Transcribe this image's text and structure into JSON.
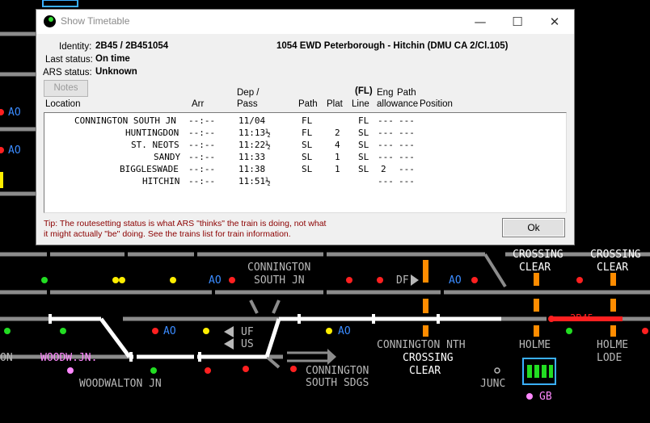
{
  "window": {
    "title": "Show Timetable",
    "controls": {
      "minimize": "—",
      "maximize": "☐",
      "close": "✕"
    }
  },
  "header": {
    "identity_label": "Identity:",
    "identity_value": "2B45 / 2B451054",
    "service": "1054 EWD Peterborough - Hitchin (DMU CA 2/Cl.105)",
    "last_status_label": "Last status:",
    "last_status_value": "On time",
    "ars_status_label": "ARS status:",
    "ars_status_value": "Unknown",
    "notes_button": "Notes"
  },
  "columns": {
    "location": "Location",
    "arr": "Arr",
    "dep1": "Dep /",
    "dep2": "Pass",
    "path": "Path",
    "plat": "Plat",
    "fl": "(FL)",
    "line": "Line",
    "eng1": "Eng",
    "eng2": "allowance",
    "path_alw1": "Path",
    "path_alw2": "Position"
  },
  "rows": [
    {
      "location": "CONNINGTON SOUTH JN",
      "arr": "--:--",
      "dep": "11/04",
      "path": "FL",
      "plat": "",
      "line": "FL",
      "eng": "---",
      "pathalw": "---"
    },
    {
      "location": "HUNTINGDON",
      "arr": "--:--",
      "dep": "11:13½",
      "path": "FL",
      "plat": "2",
      "line": "SL",
      "eng": "---",
      "pathalw": "---"
    },
    {
      "location": "ST. NEOTS",
      "arr": "--:--",
      "dep": "11:22½",
      "path": "SL",
      "plat": "4",
      "line": "SL",
      "eng": "---",
      "pathalw": "---"
    },
    {
      "location": "SANDY",
      "arr": "--:--",
      "dep": "11:33",
      "path": "SL",
      "plat": "1",
      "line": "SL",
      "eng": "---",
      "pathalw": "---"
    },
    {
      "location": "BIGGLESWADE",
      "arr": "--:--",
      "dep": "11:38",
      "path": "SL",
      "plat": "1",
      "line": "SL",
      "eng": "2",
      "pathalw": "---"
    },
    {
      "location": "HITCHIN",
      "arr": "--:--",
      "dep": "11:51½",
      "path": "",
      "plat": "",
      "line": "",
      "eng": "---",
      "pathalw": "---"
    }
  ],
  "tip_line1": "Tip: The routesetting status is what ARS \"thinks\" the train is doing, not what",
  "tip_line2": "it might actually \"be\" doing. See the trains list for train information.",
  "ok_button": "Ok",
  "map": {
    "labels": {
      "connington_south_1": "CONNINGTON",
      "connington_south_2": "SOUTH JN",
      "crossing_clear_a1": "CROSSING",
      "crossing_clear_a2": "CLEAR",
      "crossing_clear_b1": "CROSSING",
      "crossing_clear_b2": "CLEAR",
      "df": "DF",
      "ao_1": "A",
      "ao_2": "A",
      "ao_3": "A",
      "ao_4": "A",
      "ao_5": "A",
      "ao_6": "A",
      "uf": "UF",
      "us": "US",
      "on": "ON",
      "woodw_jn": "WOODW.JN.",
      "woodwalton_jn": "WOODWALTON JN",
      "connington_nth": "CONNINGTON NTH",
      "crossing_clear_c1": "CROSSING",
      "crossing_clear_c2": "CLEAR",
      "holme": "HOLME",
      "holme_lode_1": "HOLME",
      "holme_lode_2": "LODE",
      "connington_sdgs_1": "CONNINGTON",
      "connington_sdgs_2": "SOUTH SDGS",
      "junc": "JUNC",
      "gb": "GB",
      "headcode": "2B45"
    }
  },
  "colors": {
    "track": "#8c8c8c",
    "route_set": "#ffffff",
    "occupied": "#ff2020",
    "crossing": "#ff8c00",
    "signal_red": "#ff2020",
    "signal_green": "#22dd22",
    "signal_yellow": "#ffee00",
    "ao_blue": "#3a8bff",
    "panel_cyan": "#3ab0ff"
  }
}
